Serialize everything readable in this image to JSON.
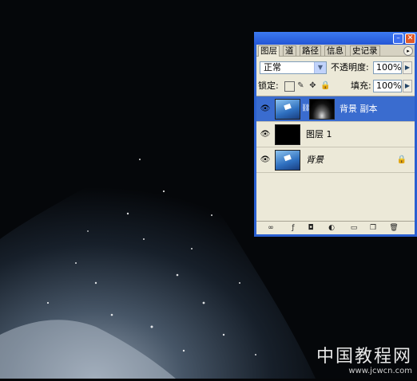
{
  "watermark": {
    "cn": "中国教程网",
    "url": "www.jcwcn.com"
  },
  "panel": {
    "tabs": [
      {
        "label": "图层",
        "active": true
      },
      {
        "label": "道"
      },
      {
        "label": "路径"
      },
      {
        "label": "信息"
      },
      {
        "label": "史记录"
      }
    ],
    "blend_mode": "正常",
    "opacity_label": "不透明度:",
    "opacity_value": "100%",
    "lock_label": "锁定:",
    "fill_label": "填充:",
    "fill_value": "100%",
    "layers": [
      {
        "name": "背景 副本",
        "thumb": "sky",
        "mask": true,
        "selected": true
      },
      {
        "name": "图层 1",
        "thumb": "black"
      },
      {
        "name": "背景",
        "thumb": "sky",
        "italic": true,
        "locked": true
      }
    ]
  },
  "colors": {
    "panel_title": "#2456d6",
    "panel_bg": "#ece9d8",
    "selected_layer": "#3a6ccf"
  },
  "icons": [
    "eye-icon",
    "link-icon",
    "lock-icon",
    "layer-style-icon",
    "mask-icon",
    "adjustment-icon",
    "group-icon",
    "new-layer-icon",
    "trash-icon"
  ]
}
